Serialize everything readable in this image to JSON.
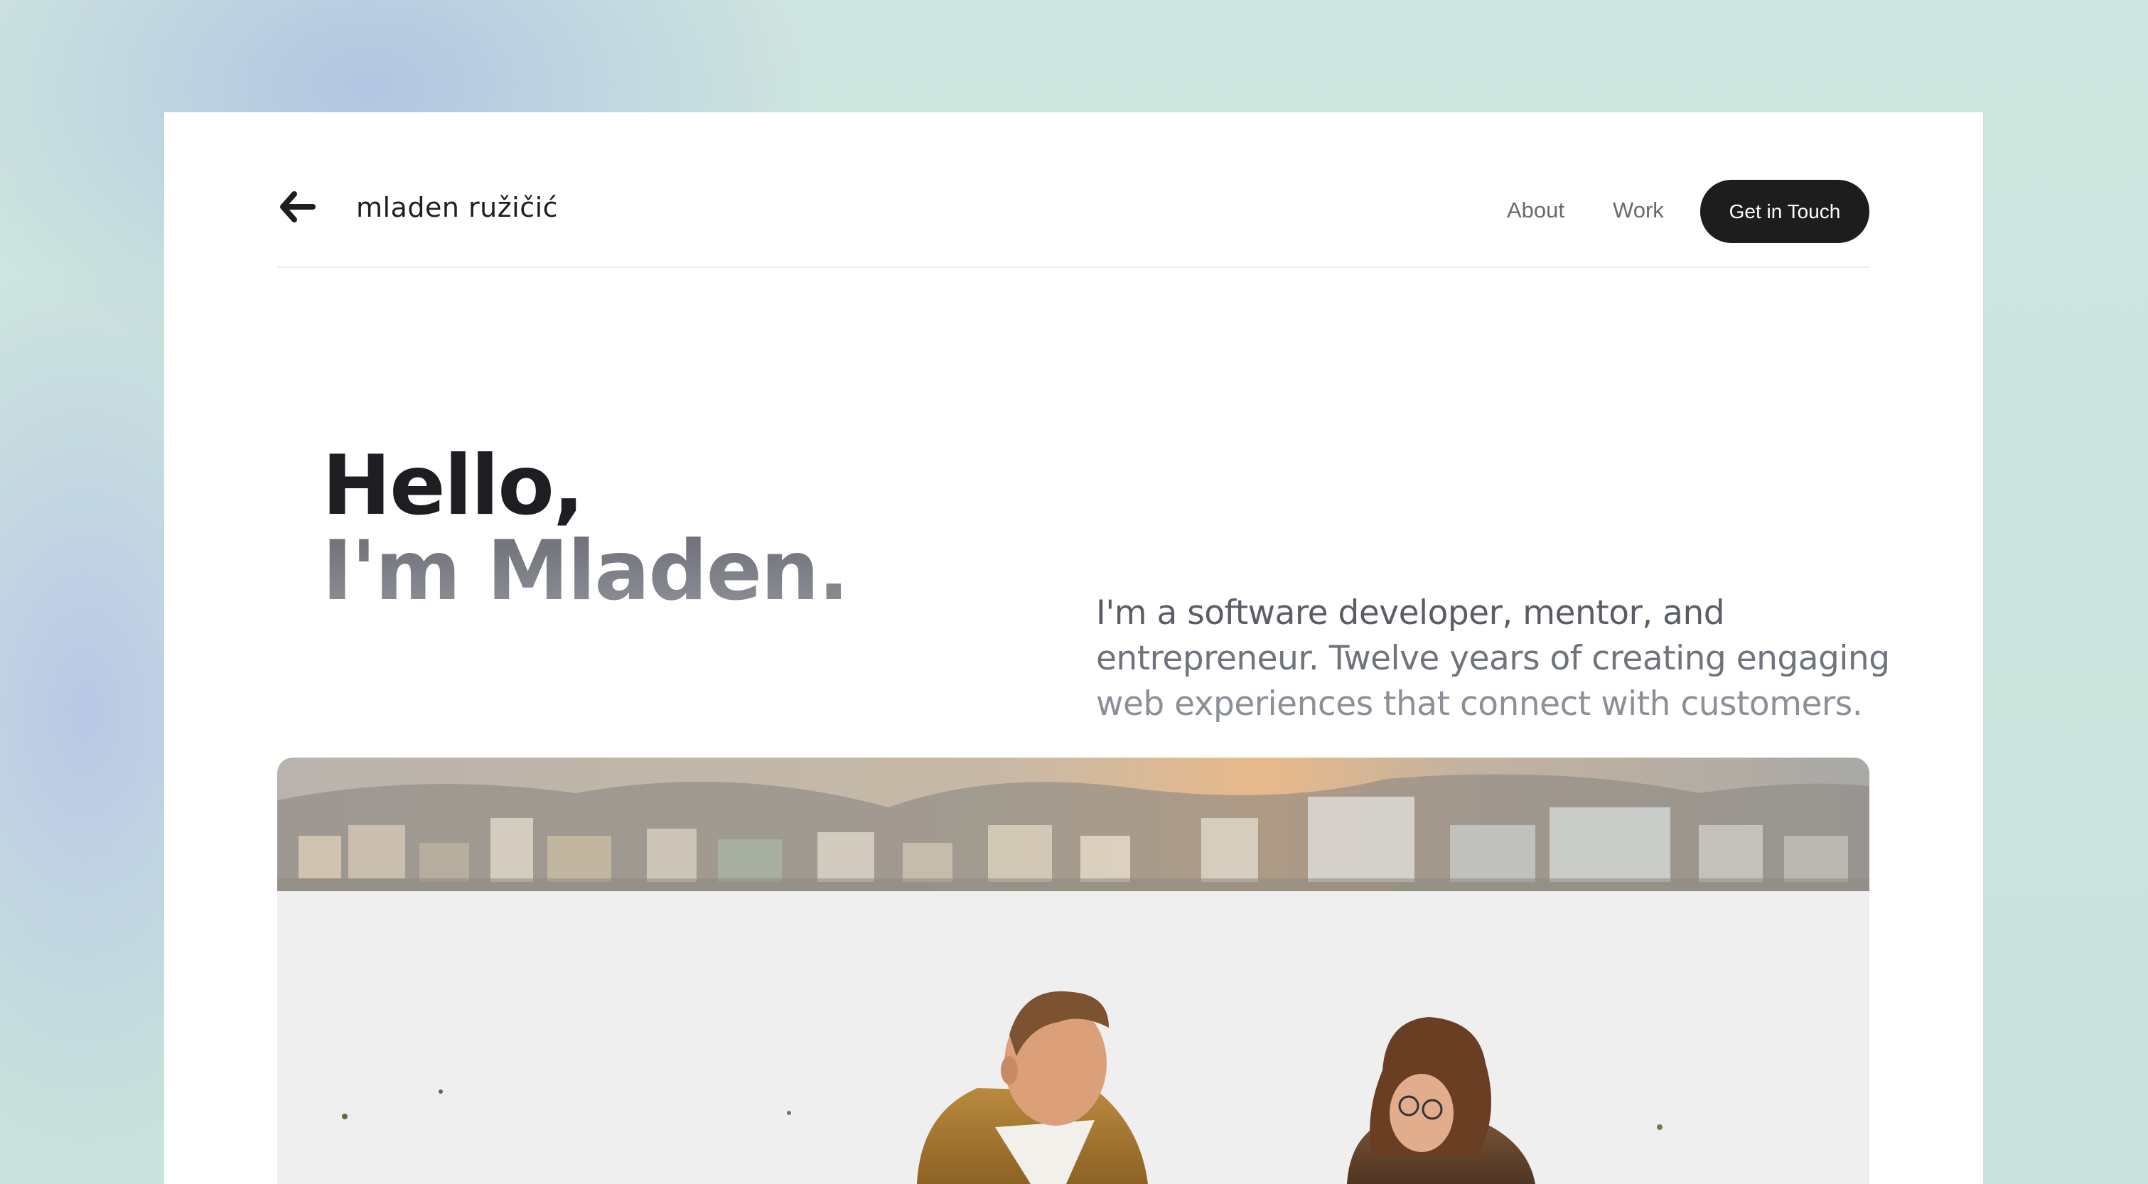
{
  "header": {
    "brand_name": "mladen ružičić",
    "nav": {
      "about_label": "About",
      "work_label": "Work",
      "cta_label": "Get in Touch"
    }
  },
  "hero": {
    "title_line1": "Hello,",
    "title_line2": "I'm Mladen.",
    "description_lines": [
      "I'm a software developer, mentor, and",
      "entrepreneur. Twelve years of creating engaging",
      "web experiences that connect with customers."
    ]
  },
  "icons": {
    "back": "arrow-left-icon"
  },
  "colors": {
    "cta_background": "#1d1d1d",
    "cta_text": "#ffffff",
    "title_primary": "#1e1e22",
    "title_secondary": "#7a7c84",
    "nav_link": "#666a70",
    "page_background": "#cfe5df"
  }
}
